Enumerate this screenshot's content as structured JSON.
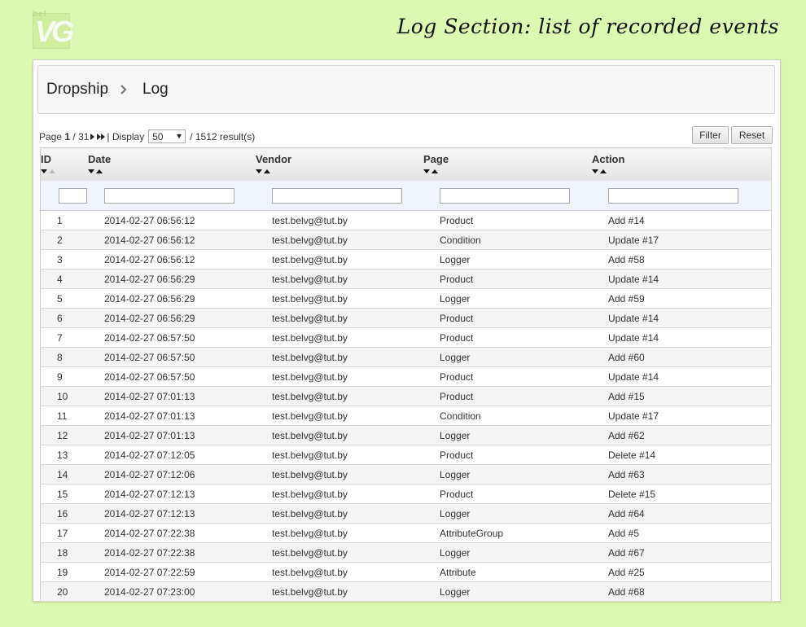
{
  "logo": {
    "top_text": "bel",
    "main_text": "VG"
  },
  "headline": "Log Section: list of recorded events",
  "breadcrumb": {
    "parent": "Dropship",
    "current": "Log"
  },
  "pager": {
    "page_label": "Page",
    "current_page": "1",
    "total_pages": "/ 31",
    "display_label": "| Display",
    "per_page": "50",
    "results": "/ 1512 result(s)"
  },
  "buttons": {
    "filter": "Filter",
    "reset": "Reset"
  },
  "columns": {
    "id": "ID",
    "date": "Date",
    "vendor": "Vendor",
    "page": "Page",
    "action": "Action"
  },
  "rows": [
    {
      "id": "1",
      "date": "2014-02-27 06:56:12",
      "vendor": "test.belvg@tut.by",
      "page": "Product",
      "action": "Add #14"
    },
    {
      "id": "2",
      "date": "2014-02-27 06:56:12",
      "vendor": "test.belvg@tut.by",
      "page": "Condition",
      "action": "Update #17"
    },
    {
      "id": "3",
      "date": "2014-02-27 06:56:12",
      "vendor": "test.belvg@tut.by",
      "page": "Logger",
      "action": "Add #58"
    },
    {
      "id": "4",
      "date": "2014-02-27 06:56:29",
      "vendor": "test.belvg@tut.by",
      "page": "Product",
      "action": "Update #14"
    },
    {
      "id": "5",
      "date": "2014-02-27 06:56:29",
      "vendor": "test.belvg@tut.by",
      "page": "Logger",
      "action": "Add #59"
    },
    {
      "id": "6",
      "date": "2014-02-27 06:56:29",
      "vendor": "test.belvg@tut.by",
      "page": "Product",
      "action": "Update #14"
    },
    {
      "id": "7",
      "date": "2014-02-27 06:57:50",
      "vendor": "test.belvg@tut.by",
      "page": "Product",
      "action": "Update #14"
    },
    {
      "id": "8",
      "date": "2014-02-27 06:57:50",
      "vendor": "test.belvg@tut.by",
      "page": "Logger",
      "action": "Add #60"
    },
    {
      "id": "9",
      "date": "2014-02-27 06:57:50",
      "vendor": "test.belvg@tut.by",
      "page": "Product",
      "action": "Update #14"
    },
    {
      "id": "10",
      "date": "2014-02-27 07:01:13",
      "vendor": "test.belvg@tut.by",
      "page": "Product",
      "action": "Add #15"
    },
    {
      "id": "11",
      "date": "2014-02-27 07:01:13",
      "vendor": "test.belvg@tut.by",
      "page": "Condition",
      "action": "Update #17"
    },
    {
      "id": "12",
      "date": "2014-02-27 07:01:13",
      "vendor": "test.belvg@tut.by",
      "page": "Logger",
      "action": "Add #62"
    },
    {
      "id": "13",
      "date": "2014-02-27 07:12:05",
      "vendor": "test.belvg@tut.by",
      "page": "Product",
      "action": "Delete #14"
    },
    {
      "id": "14",
      "date": "2014-02-27 07:12:06",
      "vendor": "test.belvg@tut.by",
      "page": "Logger",
      "action": "Add #63"
    },
    {
      "id": "15",
      "date": "2014-02-27 07:12:13",
      "vendor": "test.belvg@tut.by",
      "page": "Product",
      "action": "Delete #15"
    },
    {
      "id": "16",
      "date": "2014-02-27 07:12:13",
      "vendor": "test.belvg@tut.by",
      "page": "Logger",
      "action": "Add #64"
    },
    {
      "id": "17",
      "date": "2014-02-27 07:22:38",
      "vendor": "test.belvg@tut.by",
      "page": "AttributeGroup",
      "action": "Add #5"
    },
    {
      "id": "18",
      "date": "2014-02-27 07:22:38",
      "vendor": "test.belvg@tut.by",
      "page": "Logger",
      "action": "Add #67"
    },
    {
      "id": "19",
      "date": "2014-02-27 07:22:59",
      "vendor": "test.belvg@tut.by",
      "page": "Attribute",
      "action": "Add #25"
    },
    {
      "id": "20",
      "date": "2014-02-27 07:23:00",
      "vendor": "test.belvg@tut.by",
      "page": "Logger",
      "action": "Add #68"
    }
  ]
}
